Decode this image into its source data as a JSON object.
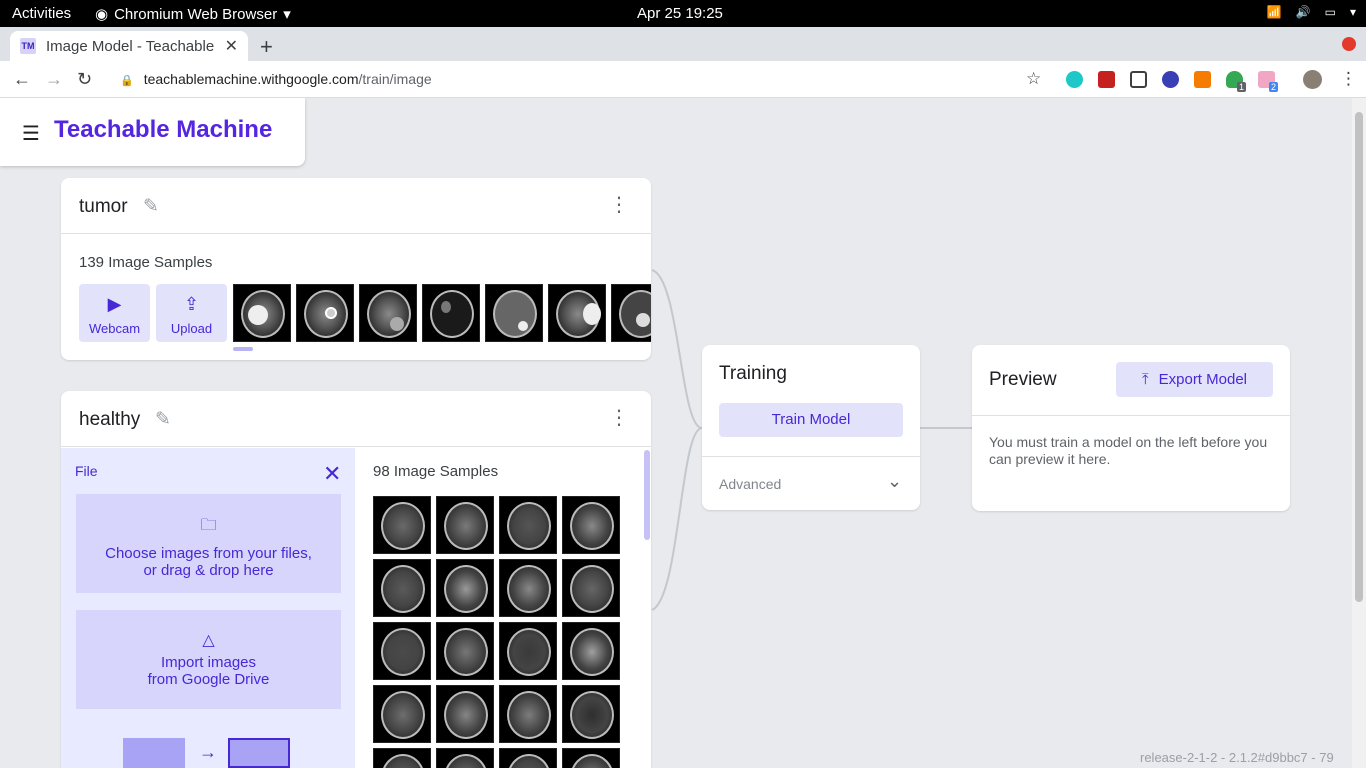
{
  "system": {
    "activities": "Activities",
    "app_name": "Chromium Web Browser",
    "clock": "Apr 25  19:25"
  },
  "browser": {
    "tab_title": "Image Model - Teachable",
    "tab_favicon": "TM",
    "url_host": "teachablemachine.withgoogle.com",
    "url_path": "/train/image",
    "ext_badges": [
      "1",
      "2"
    ]
  },
  "app": {
    "name": "Teachable Machine"
  },
  "classes": [
    {
      "title": "tumor",
      "samples_label": "139 Image Samples",
      "webcam_label": "Webcam",
      "upload_label": "Upload"
    },
    {
      "title": "healthy",
      "samples_label": "98 Image Samples"
    }
  ],
  "upload_panel": {
    "header": "File",
    "choose_line1": "Choose images from your files,",
    "choose_line2": "or drag & drop here",
    "drive_line1": "Import images",
    "drive_line2": "from Google Drive"
  },
  "training": {
    "title": "Training",
    "train_button": "Train Model",
    "advanced": "Advanced"
  },
  "preview": {
    "title": "Preview",
    "export_button": "Export Model",
    "message": "You must train a model on the left before you can preview it here."
  },
  "footer": {
    "release": "release-2-1-2 - 2.1.2#d9bbc7 - 79"
  },
  "colors": {
    "brand": "#5426e0",
    "accent_bg": "#e3e2fb",
    "accent_text": "#4628d6"
  }
}
